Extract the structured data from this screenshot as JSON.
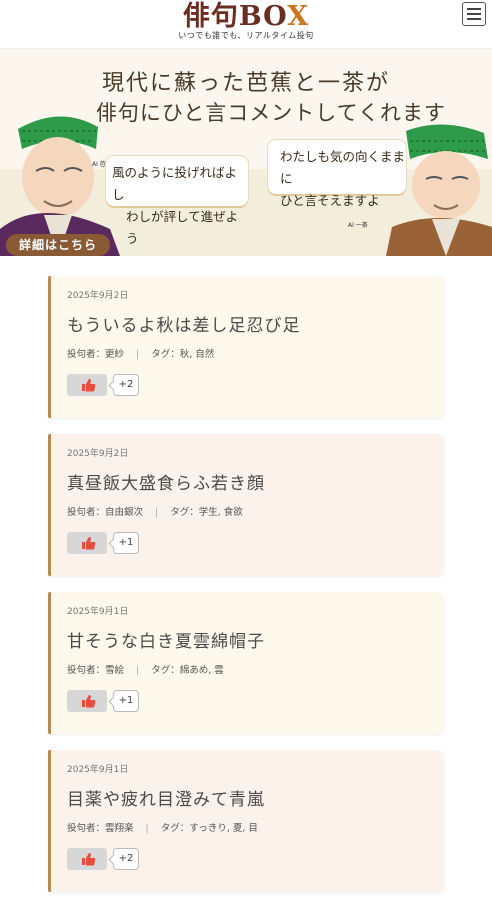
{
  "header": {
    "logo_title": "俳句BO",
    "logo_title_x": "X",
    "logo_subtitle": "いつでも誰でも、リアルタイム投句"
  },
  "banner": {
    "line1": "現代に蘇った芭蕉と一茶が",
    "line2": "俳句にひと言コメントしてくれます",
    "basho_label": "AI 芭蕉",
    "basho_bubble": [
      "風のように投げればよし",
      "わしが評して進ぜよう"
    ],
    "issa_label": "AI 一茶",
    "issa_bubble": [
      "わたしも気の向くままに",
      "ひと言そえますよ"
    ],
    "detail_button": "詳細はこちら"
  },
  "posts": [
    {
      "date": "2025年9月2日",
      "haiku": "もういるよ秋は差し足忍び足",
      "author": "投句者：更紗",
      "tags": "タグ：秋, 自然",
      "likes": "+2"
    },
    {
      "date": "2025年9月2日",
      "haiku": "真昼飯大盛食らふ若き顔",
      "author": "投句者：自由銀次",
      "tags": "タグ：学生, 食欲",
      "likes": "+1"
    },
    {
      "date": "2025年9月1日",
      "haiku": "甘そうな白き夏雲綿帽子",
      "author": "投句者：雪絵",
      "tags": "タグ：綿あめ, 雲",
      "likes": "+1"
    },
    {
      "date": "2025年9月1日",
      "haiku": "目薬や疲れ目澄みて青嵐",
      "author": "投句者：雲翔楽",
      "tags": "タグ：すっきり, 夏, 目",
      "likes": "+2"
    }
  ],
  "colors": {
    "brand": "#6b2d22",
    "accent": "#c9761f",
    "card_border": "#b98a52",
    "like_icon": "#e84c3d"
  }
}
